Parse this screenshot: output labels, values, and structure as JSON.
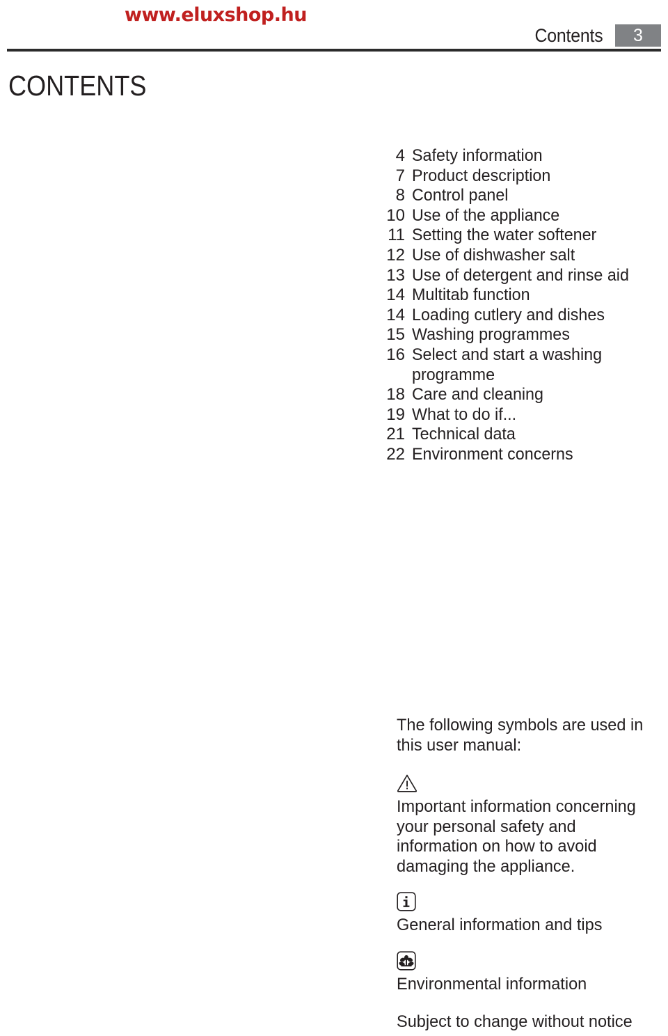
{
  "header": {
    "watermark": "www.eluxshop.hu",
    "section_label": "Contents",
    "page_number": "3",
    "badge_color": "#808285",
    "watermark_color": "#c0201f",
    "rule_color": "#2b2b2b"
  },
  "page_title": "CONTENTS",
  "toc": {
    "entries": [
      {
        "page": "4",
        "title": "Safety information"
      },
      {
        "page": "7",
        "title": "Product description"
      },
      {
        "page": "8",
        "title": "Control panel"
      },
      {
        "page": "10",
        "title": "Use of the appliance"
      },
      {
        "page": "11",
        "title": "Setting the water softener"
      },
      {
        "page": "12",
        "title": "Use of dishwasher salt"
      },
      {
        "page": "13",
        "title": "Use of detergent and rinse aid"
      },
      {
        "page": "14",
        "title": "Multitab function"
      },
      {
        "page": "14",
        "title": "Loading cutlery and dishes"
      },
      {
        "page": "15",
        "title": "Washing programmes"
      },
      {
        "page": "16",
        "title": "Select and start a washing"
      },
      {
        "page": "",
        "title": "programme",
        "continuation": true
      },
      {
        "page": "18",
        "title": "Care and cleaning"
      },
      {
        "page": "19",
        "title": "What to do if..."
      },
      {
        "page": "21",
        "title": "Technical data"
      },
      {
        "page": "22",
        "title": "Environment concerns"
      }
    ]
  },
  "legend": {
    "intro": "The following symbols are used in this user manual:",
    "items": [
      {
        "icon": "warning-triangle-icon",
        "text": "Important information concerning your personal safety and information on how to avoid damaging the appliance."
      },
      {
        "icon": "info-icon",
        "text": "General information and tips"
      },
      {
        "icon": "environment-flower-icon",
        "text": "Environmental information"
      }
    ],
    "footer": "Subject to change without notice"
  }
}
